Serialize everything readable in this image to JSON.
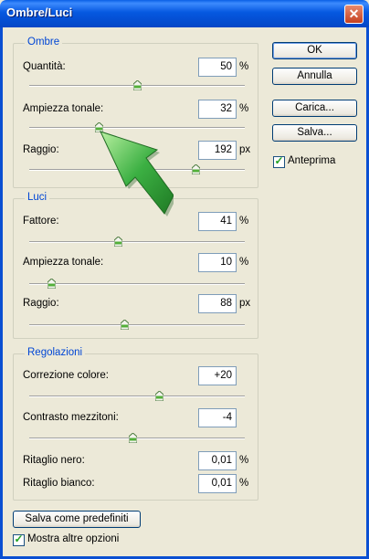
{
  "window": {
    "title": "Ombre/Luci",
    "close_glyph": "✕"
  },
  "ombre": {
    "legend": "Ombre",
    "quantita": {
      "label": "Quantità:",
      "value": "50",
      "unit": "%",
      "slider": 0.5
    },
    "ampiezza": {
      "label": "Ampiezza tonale:",
      "value": "32",
      "unit": "%",
      "slider": 0.32
    },
    "raggio": {
      "label": "Raggio:",
      "value": "192",
      "unit": "px",
      "slider": 0.77
    }
  },
  "luci": {
    "legend": "Luci",
    "fattore": {
      "label": "Fattore:",
      "value": "41",
      "unit": "%",
      "slider": 0.41
    },
    "ampiezza": {
      "label": "Ampiezza tonale:",
      "value": "10",
      "unit": "%",
      "slider": 0.1
    },
    "raggio": {
      "label": "Raggio:",
      "value": "88",
      "unit": "px",
      "slider": 0.44
    }
  },
  "regolazioni": {
    "legend": "Regolazioni",
    "correzione": {
      "label": "Correzione colore:",
      "value": "+20",
      "slider": 0.6
    },
    "contrasto": {
      "label": "Contrasto mezzitoni:",
      "value": "-4",
      "slider": 0.48
    },
    "nero": {
      "label": "Ritaglio nero:",
      "value": "0,01",
      "unit": "%"
    },
    "bianco": {
      "label": "Ritaglio bianco:",
      "value": "0,01",
      "unit": "%"
    }
  },
  "buttons": {
    "ok": "OK",
    "annulla": "Annulla",
    "carica": "Carica...",
    "salva": "Salva...",
    "salva_predefiniti": "Salva come predefiniti"
  },
  "checkboxes": {
    "anteprima": {
      "label": "Anteprima",
      "checked": true
    },
    "mostra": {
      "label": "Mostra altre opzioni",
      "checked": true
    }
  },
  "colors": {
    "accent": "#0046d5",
    "titlebar": "#0558e0",
    "arrow": "#3cb043"
  },
  "icons": {
    "close": "close-icon",
    "thumb": "slider-thumb-icon",
    "check": "checkmark-icon",
    "pointer": "green-arrow-icon"
  }
}
